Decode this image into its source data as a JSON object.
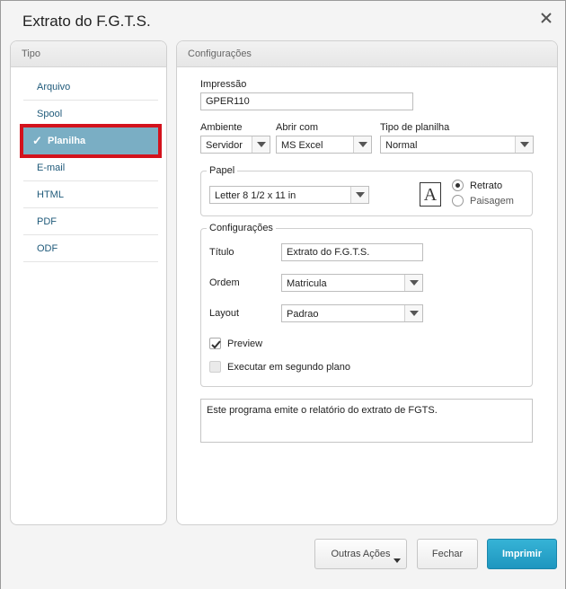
{
  "dialog": {
    "title": "Extrato do F.G.T.S."
  },
  "left": {
    "header": "Tipo",
    "items": [
      {
        "label": "Arquivo"
      },
      {
        "label": "Spool"
      },
      {
        "label": "Planilha",
        "active": true
      },
      {
        "label": "E-mail"
      },
      {
        "label": "HTML"
      },
      {
        "label": "PDF"
      },
      {
        "label": "ODF"
      }
    ]
  },
  "config": {
    "header": "Configurações",
    "impressao_label": "Impressão",
    "impressao_value": "GPER110",
    "ambiente_label": "Ambiente",
    "ambiente_value": "Servidor",
    "abrir_label": "Abrir com",
    "abrir_value": "MS Excel",
    "tipo_label": "Tipo de planilha",
    "tipo_value": "Normal",
    "papel": {
      "legend": "Papel",
      "size_value": "Letter 8 1/2 x 11 in",
      "icon_letter": "A",
      "retrato": "Retrato",
      "paisagem": "Paisagem",
      "selected": "Retrato"
    },
    "sub": {
      "legend": "Configurações",
      "titulo_label": "Título",
      "titulo_value": "Extrato do F.G.T.S.",
      "ordem_label": "Ordem",
      "ordem_value": "Matricula",
      "layout_label": "Layout",
      "layout_value": "Padrao",
      "preview_label": "Preview",
      "preview_checked": true,
      "segundo_label": "Executar em segundo plano",
      "segundo_checked": false
    },
    "description": "Este programa emite o relatório do extrato de FGTS."
  },
  "footer": {
    "outras": "Outras Ações",
    "fechar": "Fechar",
    "imprimir": "Imprimir"
  },
  "colors": {
    "accent": "#1e96bf",
    "highlight": "#d3121c",
    "active_item": "#7aaec4"
  }
}
